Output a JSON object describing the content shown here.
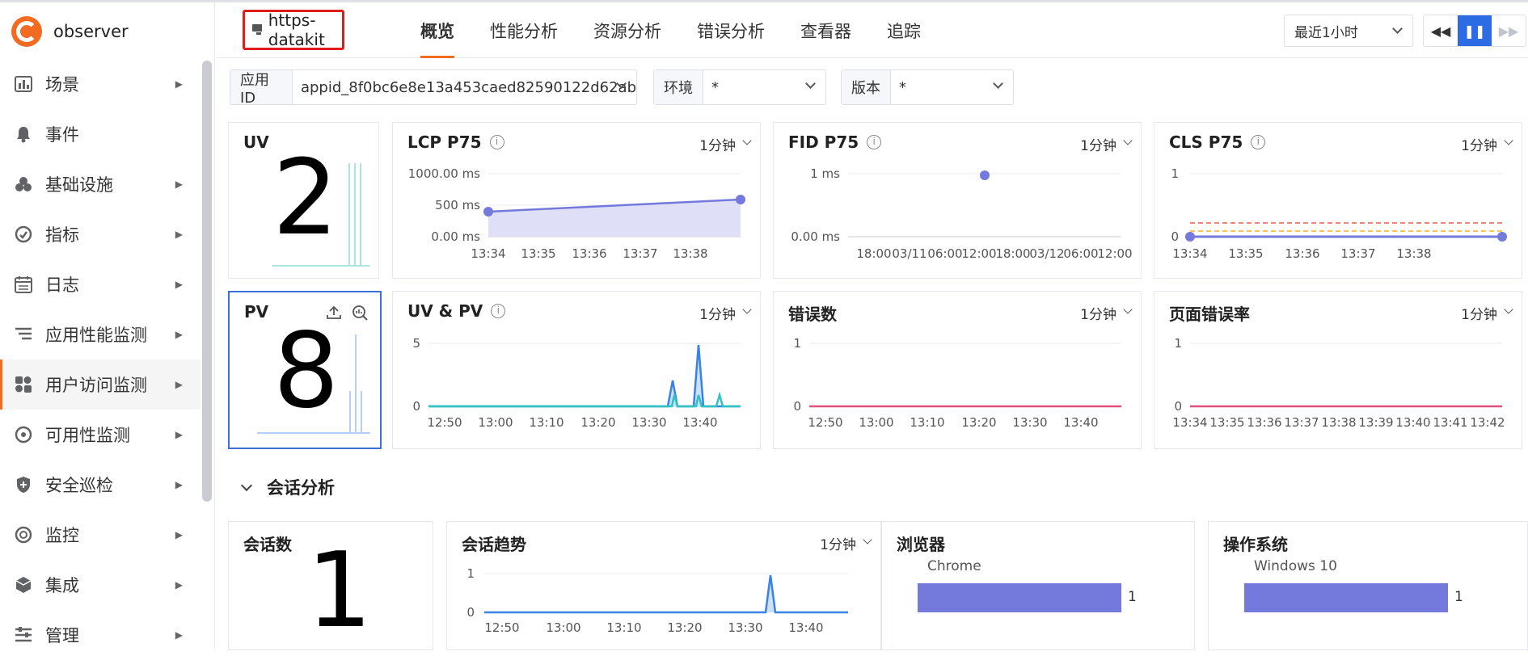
{
  "sidebar": {
    "brand": "observer",
    "items": [
      {
        "label": "场景",
        "icon": "chart-icon",
        "arrow": true
      },
      {
        "label": "事件",
        "icon": "bell-icon",
        "arrow": false
      },
      {
        "label": "基础设施",
        "icon": "cubes-icon",
        "arrow": true
      },
      {
        "label": "指标",
        "icon": "gauge-icon",
        "arrow": true
      },
      {
        "label": "日志",
        "icon": "calendar-icon",
        "arrow": true
      },
      {
        "label": "应用性能监测",
        "icon": "apm-icon",
        "arrow": true
      },
      {
        "label": "用户访问监测",
        "icon": "rum-icon",
        "arrow": true
      },
      {
        "label": "可用性监测",
        "icon": "dial-icon",
        "arrow": true
      },
      {
        "label": "安全巡检",
        "icon": "shield-icon",
        "arrow": true
      },
      {
        "label": "监控",
        "icon": "monitor-icon",
        "arrow": true
      },
      {
        "label": "集成",
        "icon": "box-icon",
        "arrow": true
      },
      {
        "label": "管理",
        "icon": "settings-icon",
        "arrow": true
      }
    ]
  },
  "header": {
    "app_name": "https-datakit",
    "tabs": [
      "概览",
      "性能分析",
      "资源分析",
      "错误分析",
      "查看器",
      "追踪"
    ],
    "time_range": "最近1小时"
  },
  "filters": {
    "app_id_label": "应用 ID",
    "app_id_value": "appid_8f0bc6e8e13a453caed82590122d62ab",
    "env_label": "环境",
    "env_value": "*",
    "version_label": "版本",
    "version_value": "*"
  },
  "cards": {
    "uv": {
      "title": "UV",
      "value": "2"
    },
    "pv": {
      "title": "PV",
      "value": "8"
    },
    "lcp": {
      "title": "LCP P75",
      "interval": "1分钟"
    },
    "fid": {
      "title": "FID P75",
      "interval": "1分钟"
    },
    "cls": {
      "title": "CLS P75",
      "interval": "1分钟"
    },
    "uvpv": {
      "title": "UV & PV",
      "interval": "1分钟"
    },
    "errors": {
      "title": "错误数",
      "interval": "1分钟"
    },
    "error_rate": {
      "title": "页面错误率",
      "interval": "1分钟"
    }
  },
  "section": {
    "title": "会话分析"
  },
  "session": {
    "count_title": "会话数",
    "count_value": "1",
    "trend_title": "会话趋势",
    "trend_interval": "1分钟",
    "browser_title": "浏览器",
    "browser_label": "Chrome",
    "browser_value": "1",
    "os_title": "操作系统",
    "os_label": "Windows 10",
    "os_value": "1"
  },
  "chart_data": [
    {
      "type": "area",
      "title": "LCP P75",
      "x": [
        "13:34",
        "13:39"
      ],
      "y": [
        400,
        550
      ],
      "xticks": [
        "13:34",
        "13:35",
        "13:36",
        "13:37",
        "13:38"
      ],
      "yticks": [
        "0.00 ms",
        "500 ms",
        "1000.00 ms"
      ],
      "ylim": [
        0,
        1000
      ],
      "color": "#7479dc"
    },
    {
      "type": "scatter",
      "title": "FID P75",
      "x": [
        "03/11 12:00"
      ],
      "y": [
        1
      ],
      "xticks": [
        "18:00",
        "03/11",
        "06:00",
        "12:00",
        "18:00",
        "03/12",
        "06:00",
        "12:00"
      ],
      "yticks": [
        "0.00 ms",
        "1 ms"
      ],
      "color": "#7479dc"
    },
    {
      "type": "line",
      "title": "CLS P75",
      "x": [
        "13:34",
        "13:39"
      ],
      "y": [
        0,
        0
      ],
      "xticks": [
        "13:34",
        "13:35",
        "13:36",
        "13:37",
        "13:38"
      ],
      "yticks": [
        "0",
        "1"
      ],
      "ylim": [
        0,
        1
      ],
      "color": "#7479dc"
    },
    {
      "type": "area",
      "title": "UV & PV",
      "xticks": [
        "12:50",
        "13:00",
        "13:10",
        "13:20",
        "13:30",
        "13:40"
      ],
      "yticks": [
        "0",
        "5"
      ],
      "ylim": [
        0,
        5
      ],
      "series": [
        {
          "values_at": {
            "13:34": 2,
            "13:37": 5,
            "13:41": 1
          },
          "color": "#3b82e6"
        },
        {
          "values_at": {
            "13:34": 1,
            "13:37": 1,
            "13:41": 1
          },
          "color": "#2dc3c3"
        }
      ]
    },
    {
      "type": "line",
      "title": "错误数",
      "xticks": [
        "12:50",
        "13:00",
        "13:10",
        "13:20",
        "13:30",
        "13:40"
      ],
      "yticks": [
        "0",
        "1"
      ],
      "ylim": [
        0,
        1
      ],
      "values": [
        0
      ],
      "color": "#e0507a"
    },
    {
      "type": "line",
      "title": "页面错误率",
      "xticks": [
        "13:34",
        "13:35",
        "13:36",
        "13:37",
        "13:38",
        "13:39",
        "13:40",
        "13:41",
        "13:42"
      ],
      "yticks": [
        "0",
        "1"
      ],
      "ylim": [
        0,
        1
      ],
      "values": [
        0
      ],
      "color": "#e0507a"
    },
    {
      "type": "area",
      "title": "会话趋势",
      "xticks": [
        "12:50",
        "13:00",
        "13:10",
        "13:20",
        "13:30",
        "13:40"
      ],
      "yticks": [
        "0",
        "1"
      ],
      "ylim": [
        0,
        1
      ],
      "values_at": {
        "13:34": 1
      },
      "color": "#3b82e6"
    },
    {
      "type": "bar",
      "title": "浏览器",
      "categories": [
        "Chrome"
      ],
      "values": [
        1
      ],
      "color": "#7479dc"
    },
    {
      "type": "bar",
      "title": "操作系统",
      "categories": [
        "Windows 10"
      ],
      "values": [
        1
      ],
      "color": "#7479dc"
    }
  ]
}
